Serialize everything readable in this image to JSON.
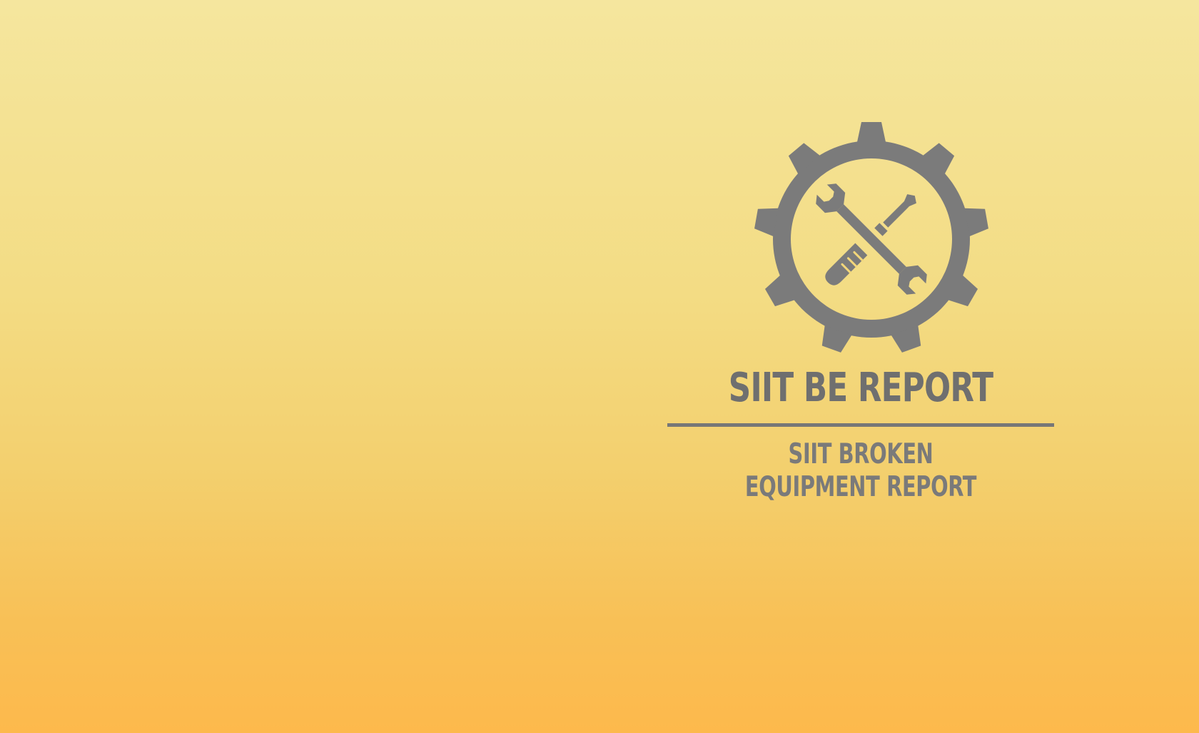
{
  "brand": {
    "title": "SIIT BE REPORT",
    "subtitle": "SIIT BROKEN EQUIPMENT REPORT",
    "logo_icon": "gear-with-crossed-wrench-and-screwdriver-icon"
  },
  "colors": {
    "logo": "#7b7b7b",
    "title": "#6f6f6f",
    "subtitle": "#7a7a7a",
    "background_top": "#f5e69e",
    "background_bottom": "#fdb94c"
  }
}
